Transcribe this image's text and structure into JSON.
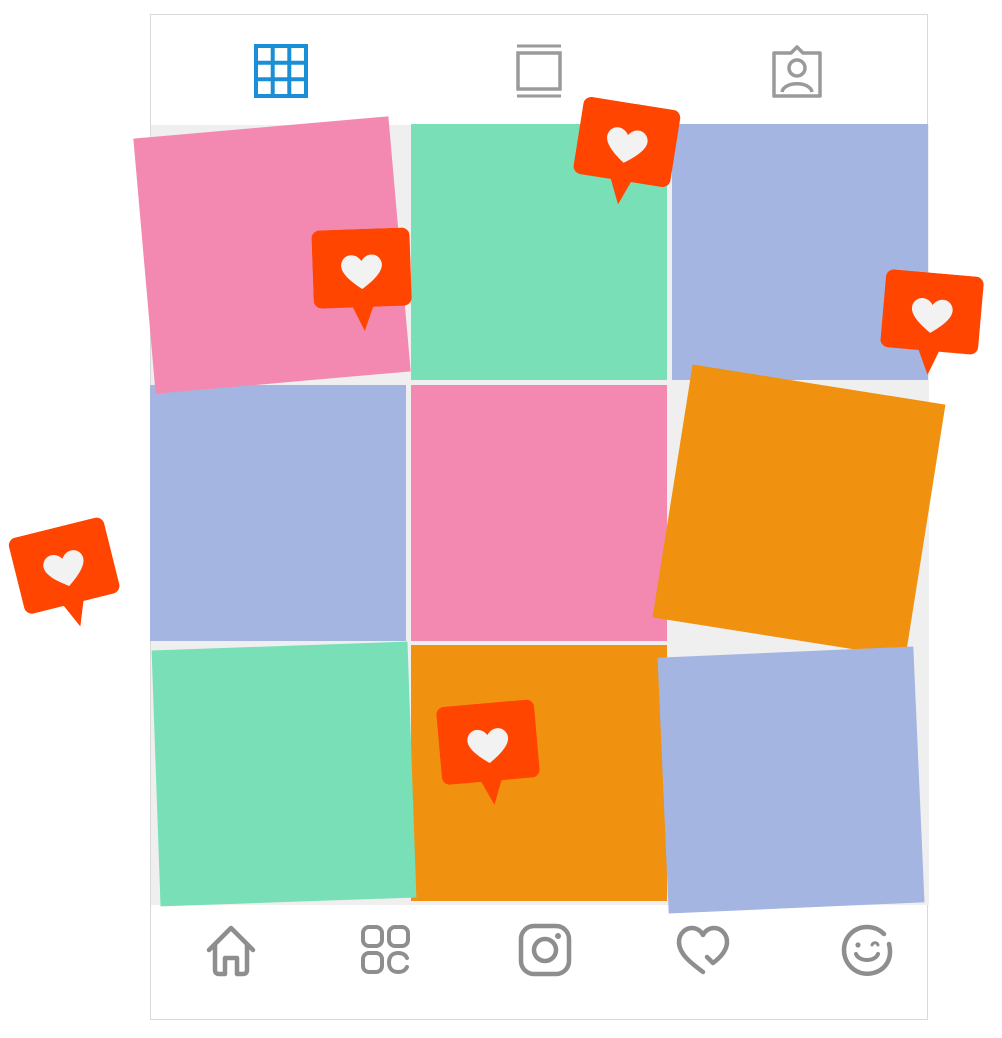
{
  "profile_tabs": [
    {
      "icon": "grid-icon",
      "active": true
    },
    {
      "icon": "feed-icon",
      "active": false
    },
    {
      "icon": "tagged-user-icon",
      "active": false
    }
  ],
  "posts": [
    {
      "row": 1,
      "col": 1,
      "color": "#f389b1",
      "tilted": true
    },
    {
      "row": 1,
      "col": 2,
      "color": "#78dfb7",
      "tilted": false
    },
    {
      "row": 1,
      "col": 3,
      "color": "#a3b5e0",
      "tilted": false
    },
    {
      "row": 2,
      "col": 1,
      "color": "#a3b5e0",
      "tilted": false
    },
    {
      "row": 2,
      "col": 2,
      "color": "#f389b1",
      "tilted": false
    },
    {
      "row": 2,
      "col": 3,
      "color": "#f0910f",
      "tilted": true
    },
    {
      "row": 3,
      "col": 1,
      "color": "#78dfb7",
      "tilted": true
    },
    {
      "row": 3,
      "col": 2,
      "color": "#f0910f",
      "tilted": false
    },
    {
      "row": 3,
      "col": 3,
      "color": "#a3b5e0",
      "tilted": true
    }
  ],
  "like_notifications": [
    {
      "icon": "heart-icon",
      "color": "#ff4500"
    },
    {
      "icon": "heart-icon",
      "color": "#ff4500"
    },
    {
      "icon": "heart-icon",
      "color": "#ff4500"
    },
    {
      "icon": "heart-icon",
      "color": "#ff4500"
    },
    {
      "icon": "heart-icon",
      "color": "#ff4500"
    }
  ],
  "bottom_nav": [
    {
      "icon": "home-icon"
    },
    {
      "icon": "explore-icon"
    },
    {
      "icon": "camera-icon"
    },
    {
      "icon": "heart-icon"
    },
    {
      "icon": "profile-smile-icon"
    }
  ],
  "colors": {
    "accent": "#1a8fd6",
    "icon_gray": "#8e8e8e",
    "like_orange": "#ff4500",
    "grid_background": "#efefef"
  }
}
